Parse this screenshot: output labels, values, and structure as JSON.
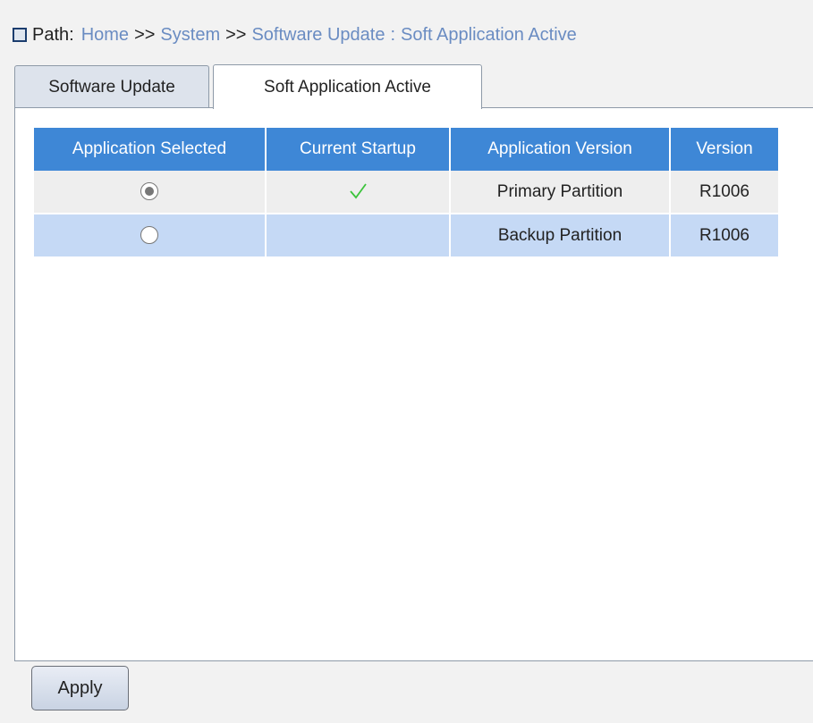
{
  "breadcrumb": {
    "prefix": "Path:",
    "items": [
      "Home",
      "System",
      "Software Update"
    ],
    "separator": ">>",
    "current": "Soft Application Active",
    "current_separator": ":"
  },
  "tabs": [
    {
      "label": "Software Update",
      "active": false
    },
    {
      "label": "Soft Application Active",
      "active": true
    }
  ],
  "table": {
    "headers": [
      "Application Selected",
      "Current Startup",
      "Application Version",
      "Version"
    ],
    "rows": [
      {
        "selected": true,
        "current_startup": true,
        "application_version": "Primary Partition",
        "version": "R1006"
      },
      {
        "selected": false,
        "current_startup": false,
        "application_version": "Backup Partition",
        "version": "R1006"
      }
    ]
  },
  "apply_label": "Apply",
  "colors": {
    "header_bg": "#3e87d6",
    "link": "#6a8cc2",
    "row_alt": "#c5d9f5",
    "check": "#3cc43c"
  },
  "icons": {
    "breadcrumb": "square-icon",
    "startup": "check-icon"
  }
}
